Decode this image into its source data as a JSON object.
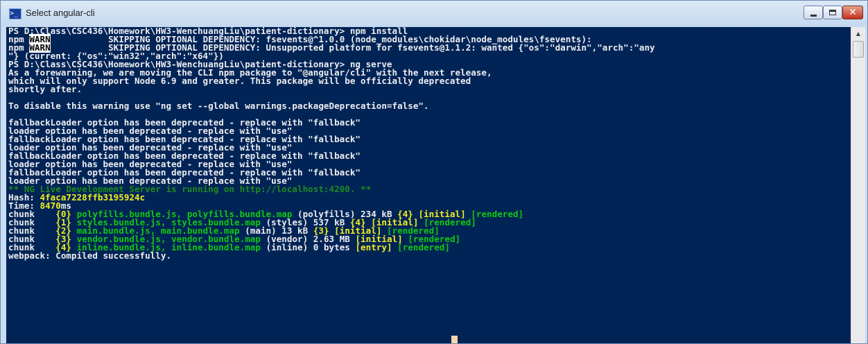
{
  "window": {
    "title": "Select angular-cli",
    "icon": "powershell-icon",
    "controls": {
      "close_glyph": "✕"
    }
  },
  "console": {
    "lines": [
      [
        {
          "t": "PS D:\\Class\\CSC436\\Homework\\HW3-WenchuangLiu\\patient-dictionary> npm install",
          "c": "w"
        }
      ],
      [
        {
          "t": "npm ",
          "c": "w"
        },
        {
          "t": "WARN",
          "c": "warn"
        },
        {
          "t": "           SKIPPING OPTIONAL DEPENDENCY: fsevents@^1.0.0 (node_modules\\chokidar\\node_modules\\fsevents):",
          "c": "w"
        }
      ],
      [
        {
          "t": "npm ",
          "c": "w"
        },
        {
          "t": "WARN",
          "c": "warn"
        },
        {
          "t": "           SKIPPING OPTIONAL DEPENDENCY: Unsupported platform for fsevents@1.1.2: wanted {\"os\":\"darwin\",\"arch\":\"any",
          "c": "w"
        }
      ],
      [
        {
          "t": "\"} (current: {\"os\":\"win32\",\"arch\":\"x64\"})",
          "c": "w"
        }
      ],
      [
        {
          "t": "PS D:\\Class\\CSC436\\Homework\\HW3-WenchuangLiu\\patient-dictionary> ng serve",
          "c": "w"
        }
      ],
      [
        {
          "t": "As a forewarning, we are moving the CLI npm package to \"@angular/cli\" with the next release,",
          "c": "w"
        }
      ],
      [
        {
          "t": "which will only support Node 6.9 and greater. This package will be officially deprecated",
          "c": "w"
        }
      ],
      [
        {
          "t": "shortly after.",
          "c": "w"
        }
      ],
      [
        {
          "t": "",
          "c": "w"
        }
      ],
      [
        {
          "t": "To disable this warning use \"ng set --global warnings.packageDeprecation=false\".",
          "c": "w"
        }
      ],
      [
        {
          "t": "",
          "c": "w"
        }
      ],
      [
        {
          "t": "fallbackLoader option has been deprecated - replace with \"fallback\"",
          "c": "w"
        }
      ],
      [
        {
          "t": "loader option has been deprecated - replace with \"use\"",
          "c": "w"
        }
      ],
      [
        {
          "t": "fallbackLoader option has been deprecated - replace with \"fallback\"",
          "c": "w"
        }
      ],
      [
        {
          "t": "loader option has been deprecated - replace with \"use\"",
          "c": "w"
        }
      ],
      [
        {
          "t": "fallbackLoader option has been deprecated - replace with \"fallback\"",
          "c": "w"
        }
      ],
      [
        {
          "t": "loader option has been deprecated - replace with \"use\"",
          "c": "w"
        }
      ],
      [
        {
          "t": "fallbackLoader option has been deprecated - replace with \"fallback\"",
          "c": "w"
        }
      ],
      [
        {
          "t": "loader option has been deprecated - replace with \"use\"",
          "c": "w"
        }
      ],
      [
        {
          "t": "** NG Live Development Server is running on http://localhost:4200. **",
          "c": "dg"
        }
      ],
      [
        {
          "t": "Hash: ",
          "c": "w"
        },
        {
          "t": "4faca7228ffb3195924c",
          "c": "y"
        }
      ],
      [
        {
          "t": "Time: ",
          "c": "w"
        },
        {
          "t": "8470",
          "c": "y"
        },
        {
          "t": "ms",
          "c": "w"
        }
      ],
      [
        {
          "t": "chunk    ",
          "c": "w"
        },
        {
          "t": "{0} ",
          "c": "y"
        },
        {
          "t": "polyfills.bundle.js, polyfills.bundle.map ",
          "c": "g"
        },
        {
          "t": "(polyfills) 234 kB ",
          "c": "w"
        },
        {
          "t": "{4} ",
          "c": "y"
        },
        {
          "t": "[initial] ",
          "c": "y"
        },
        {
          "t": "[rendered]",
          "c": "g"
        }
      ],
      [
        {
          "t": "chunk    ",
          "c": "w"
        },
        {
          "t": "{1} ",
          "c": "y"
        },
        {
          "t": "styles.bundle.js, styles.bundle.map ",
          "c": "g"
        },
        {
          "t": "(styles) 537 kB ",
          "c": "w"
        },
        {
          "t": "{4} ",
          "c": "y"
        },
        {
          "t": "[initial] ",
          "c": "y"
        },
        {
          "t": "[rendered]",
          "c": "g"
        }
      ],
      [
        {
          "t": "chunk    ",
          "c": "w"
        },
        {
          "t": "{2} ",
          "c": "y"
        },
        {
          "t": "main.bundle.js, main.bundle.map ",
          "c": "g"
        },
        {
          "t": "(main) 13 kB ",
          "c": "w"
        },
        {
          "t": "{3} ",
          "c": "y"
        },
        {
          "t": "[initial] ",
          "c": "y"
        },
        {
          "t": "[rendered]",
          "c": "g"
        }
      ],
      [
        {
          "t": "chunk    ",
          "c": "w"
        },
        {
          "t": "{3} ",
          "c": "y"
        },
        {
          "t": "vendor.bundle.js, vendor.bundle.map ",
          "c": "g"
        },
        {
          "t": "(vendor) 2.63 MB ",
          "c": "w"
        },
        {
          "t": "[initial] ",
          "c": "y"
        },
        {
          "t": "[rendered]",
          "c": "g"
        }
      ],
      [
        {
          "t": "chunk    ",
          "c": "w"
        },
        {
          "t": "{4} ",
          "c": "y"
        },
        {
          "t": "inline.bundle.js, inline.bundle.map ",
          "c": "g"
        },
        {
          "t": "(inline) 0 bytes ",
          "c": "w"
        },
        {
          "t": "[entry] ",
          "c": "y"
        },
        {
          "t": "[rendered]",
          "c": "g"
        }
      ],
      [
        {
          "t": "webpack: Compiled successfully.",
          "c": "w"
        }
      ]
    ]
  },
  "colors": {
    "console_background": "#012456",
    "text_default": "#eeedf0",
    "text_yellow": "#f0ee1e",
    "text_green": "#12c712",
    "text_dark_green": "#1f8a1f",
    "cursor": "#f5d6ad"
  }
}
